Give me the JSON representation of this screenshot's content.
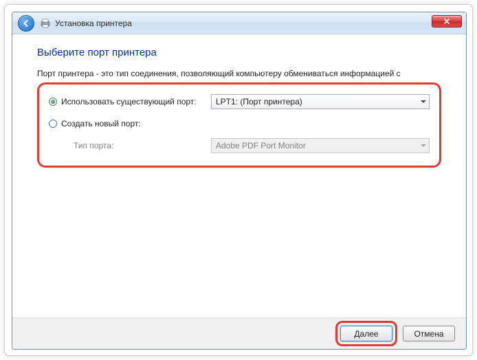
{
  "titlebar": {
    "back_icon": "back-arrow-icon",
    "printer_icon": "printer-icon",
    "title": "Установка принтера",
    "close_icon": "close-icon"
  },
  "content": {
    "heading": "Выберите порт принтера",
    "subtext": "Порт принтера - это тип соединения, позволяющий компьютеру обмениваться информацией с",
    "options": {
      "use_existing": {
        "label": "Использовать существующий порт:",
        "selected": true,
        "value": "LPT1: (Порт принтера)"
      },
      "create_new": {
        "label": "Создать новый порт:",
        "selected": false,
        "port_type_label": "Тип порта:",
        "port_type_value": "Adobe PDF Port Monitor"
      }
    }
  },
  "footer": {
    "next_label": "Далее",
    "cancel_label": "Отмена"
  }
}
